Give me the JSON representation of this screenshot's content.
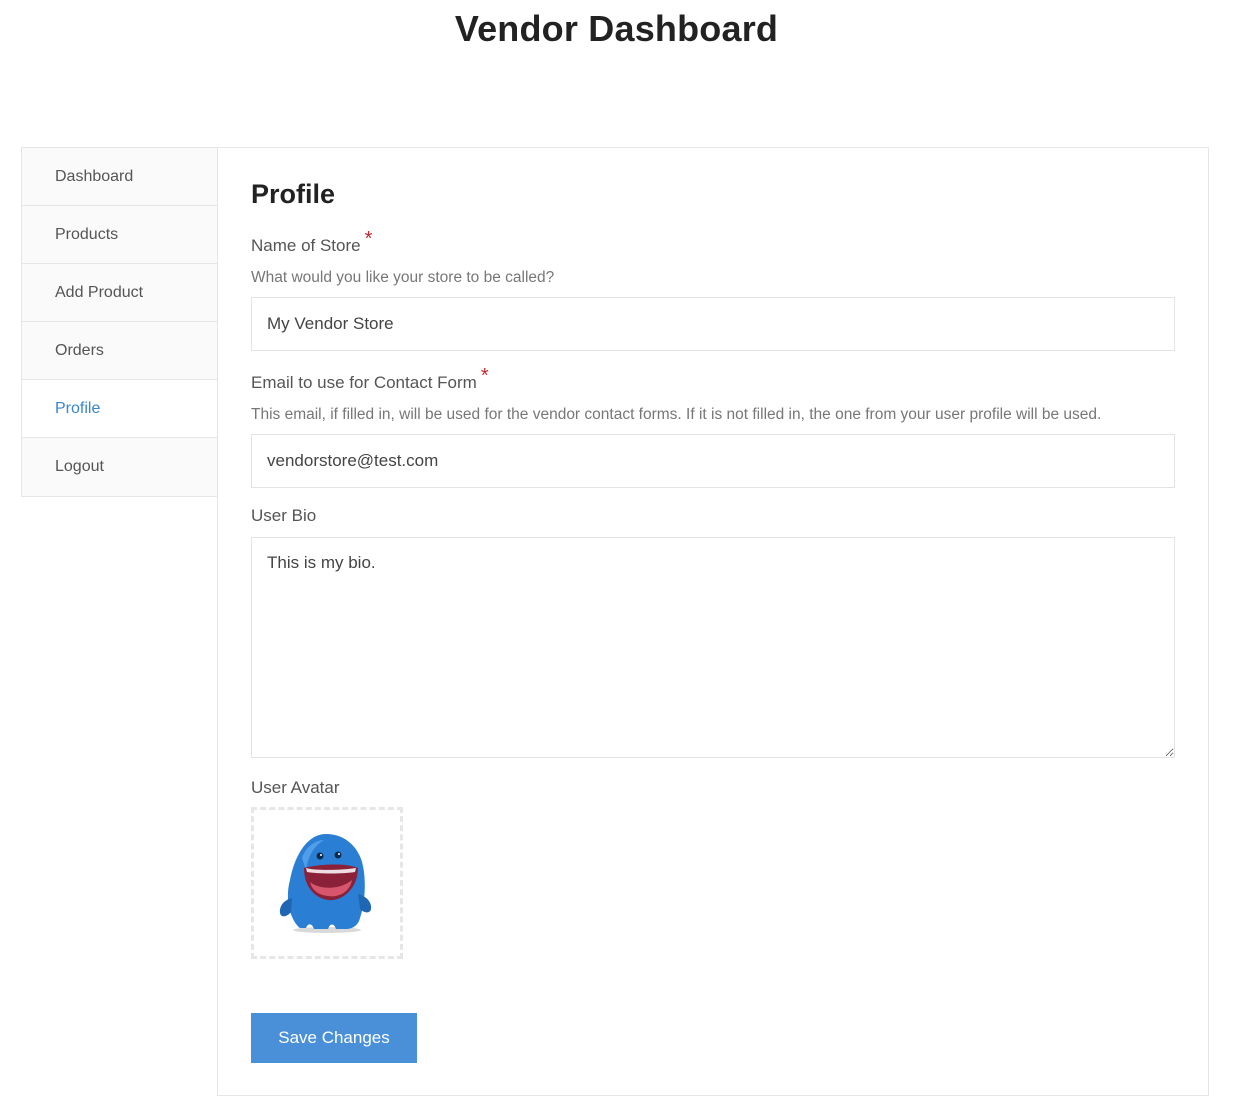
{
  "page": {
    "title": "Vendor Dashboard"
  },
  "sidebar": {
    "items": [
      {
        "label": "Dashboard",
        "active": false
      },
      {
        "label": "Products",
        "active": false
      },
      {
        "label": "Add Product",
        "active": false
      },
      {
        "label": "Orders",
        "active": false
      },
      {
        "label": "Profile",
        "active": true
      },
      {
        "label": "Logout",
        "active": false
      }
    ]
  },
  "profile": {
    "heading": "Profile",
    "store_name": {
      "label": "Name of Store",
      "required_mark": "*",
      "help": "What would you like your store to be called?",
      "value": "My Vendor Store"
    },
    "contact_email": {
      "label": "Email to use for Contact Form",
      "required_mark": "*",
      "help": "This email, if filled in, will be used for the vendor contact forms. If it is not filled in, the one from your user profile will be used.",
      "value": "vendorstore@test.com"
    },
    "bio": {
      "label": "User Bio",
      "value": "This is my bio."
    },
    "avatar": {
      "label": "User Avatar",
      "image": "blue-monster-avatar"
    },
    "save_label": "Save Changes"
  },
  "colors": {
    "accent": "#4a90d9",
    "active_link": "#3a86cf",
    "required": "#c0282e",
    "avatar_blue": "#2a7fd4"
  }
}
